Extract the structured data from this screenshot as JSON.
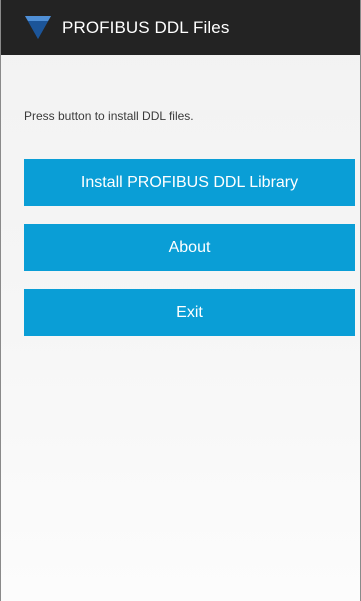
{
  "action_bar": {
    "title": "PROFIBUS DDL Files",
    "icon": "profibus-logo-icon",
    "background_color": "#232323",
    "icon_color": "#1f5fa8"
  },
  "main": {
    "instruction_text": "Press button to install DDL files.",
    "buttons": [
      {
        "label": "Install PROFIBUS DDL Library"
      },
      {
        "label": "About"
      },
      {
        "label": "Exit"
      }
    ],
    "button_color": "#0a9ed6"
  }
}
